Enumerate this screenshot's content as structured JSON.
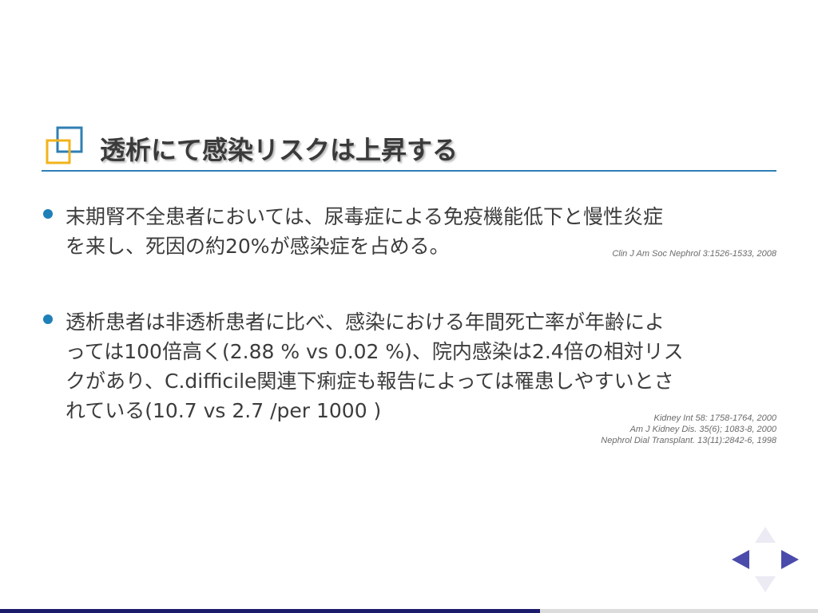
{
  "slide": {
    "title": "透析にて感染リスクは上昇する",
    "bullets": [
      {
        "lines": [
          "末期腎不全患者においては、尿毒症による免疫機能低下と慢性炎症",
          "を来し、死因の約20%が感染症を占める。"
        ],
        "citations": [
          "Clin J Am Soc Nephrol 3:1526-1533, 2008"
        ]
      },
      {
        "lines": [
          "透析患者は非透析患者に比べ、感染における年間死亡率が年齢によ",
          "っては100倍高く(2.88 % vs 0.02 %)、院内感染は2.4倍の相対リス",
          "クがあり、C.difficile関連下痢症も報告によっては罹患しやすいとさ",
          "れている(10.7 vs 2.7 /per 1000 )"
        ],
        "citations": [
          "Kidney Int 58: 1758-1764, 2000",
          "Am J Kidney Dis. 35(6); 1083-8, 2000",
          "Nephrol Dial Transplant. 13(11):2842-6, 1998"
        ]
      }
    ]
  },
  "navigation": {
    "icons": [
      "nav-up-icon",
      "nav-left-icon",
      "nav-right-icon",
      "nav-down-icon"
    ],
    "progress_fraction": 0.66
  },
  "colors": {
    "title_rule": "#2f7fb3",
    "bullet": "#1f7fb8",
    "icon_blue": "#2f7fb3",
    "icon_yellow": "#f2b31b",
    "nav_active": "#4b4bab",
    "nav_inactive": "#ecebf4",
    "progress": "#1b1b6b"
  }
}
